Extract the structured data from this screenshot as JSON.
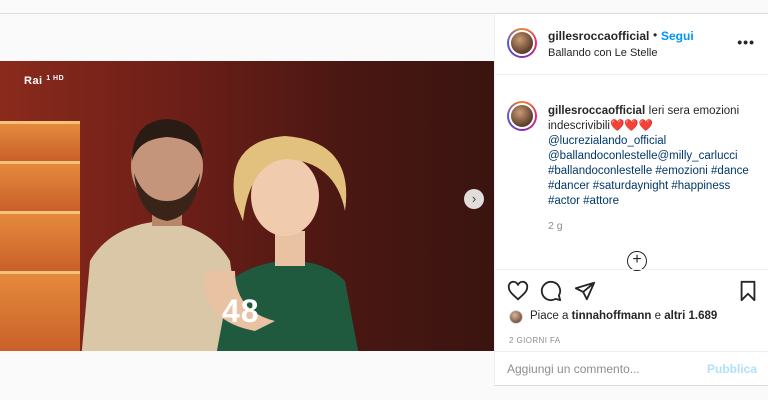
{
  "post": {
    "username": "gillesroccaofficial",
    "separator": "•",
    "follow_label": "Segui",
    "location": "Ballando con Le Stelle",
    "more_label": "•••"
  },
  "media": {
    "channel_logo": "Rai",
    "channel_logo_suffix": "1 HD",
    "score_overlay": "48",
    "next_label": "›"
  },
  "caption": {
    "username": "gillesroccaofficial",
    "text": "Ieri sera emozioni indescrivibili❤️❤️❤️",
    "mention_1": "@lucrezialando_official",
    "mention_2": "@ballandoconlestelle",
    "mention_3": "@milly_carlucci",
    "hashtags_line_1": "#ballandoconlestelle #emozioni #dance",
    "hashtags_line_2": "#dancer #saturdaynight #happiness",
    "hashtags_line_3": "#actor #attore",
    "time_ago": "2 g",
    "load_more_label": "+"
  },
  "actions": {
    "likes_prefix": "Piace a",
    "likes_user": "tinnahoffmann",
    "likes_middle": "e",
    "likes_count": "altri 1.689",
    "date": "2 GIORNI FA"
  },
  "comment": {
    "placeholder": "Aggiungi un commento...",
    "publish_label": "Pubblica"
  },
  "colors": {
    "accent": "#0095f6",
    "publish_disabled": "#b2dffc",
    "link": "#00376b"
  }
}
